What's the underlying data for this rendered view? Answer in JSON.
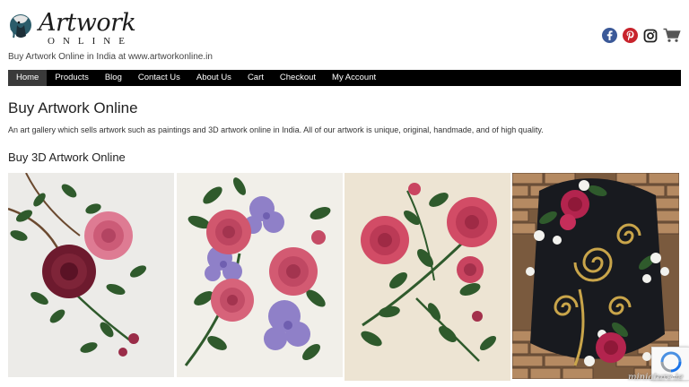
{
  "brand": {
    "logo_word": "Artwork",
    "logo_sub": "ONLINE",
    "tagline": "Buy Artwork Online in India at www.artworkonline.in"
  },
  "social": [
    {
      "name": "facebook-icon",
      "color": "#3b5998"
    },
    {
      "name": "pinterest-icon",
      "color": "#c8232c"
    },
    {
      "name": "instagram-icon",
      "color": "#222222"
    },
    {
      "name": "cart-icon",
      "color": "#555555"
    }
  ],
  "nav": {
    "items": [
      {
        "label": "Home",
        "active": true
      },
      {
        "label": "Products"
      },
      {
        "label": "Blog"
      },
      {
        "label": "Contact Us"
      },
      {
        "label": "About Us"
      },
      {
        "label": "Cart"
      },
      {
        "label": "Checkout"
      },
      {
        "label": "My Account"
      }
    ]
  },
  "main": {
    "title": "Buy Artwork Online",
    "intro": "An art gallery which sells artwork such as paintings and 3D artwork online in India. All of our artwork is unique, original, handmade, and of high quality.",
    "section_title": "Buy 3D Artwork Online"
  },
  "gallery": [
    {
      "name": "artwork-roses-white-canvas"
    },
    {
      "name": "artwork-roses-hydrangea"
    },
    {
      "name": "artwork-pink-roses-cream"
    },
    {
      "name": "artwork-brick-wall-spirals"
    }
  ],
  "recaptcha": {
    "text": "Privacy - Terms"
  },
  "watermark": "miniature.ie",
  "colors": {
    "nav_bg": "#000000",
    "nav_active": "#3a3a3a",
    "rose_pink": "#d4526a",
    "rose_deep": "#7a1f35",
    "leaf_green": "#2f5a2c",
    "lavender": "#8f80c8"
  }
}
